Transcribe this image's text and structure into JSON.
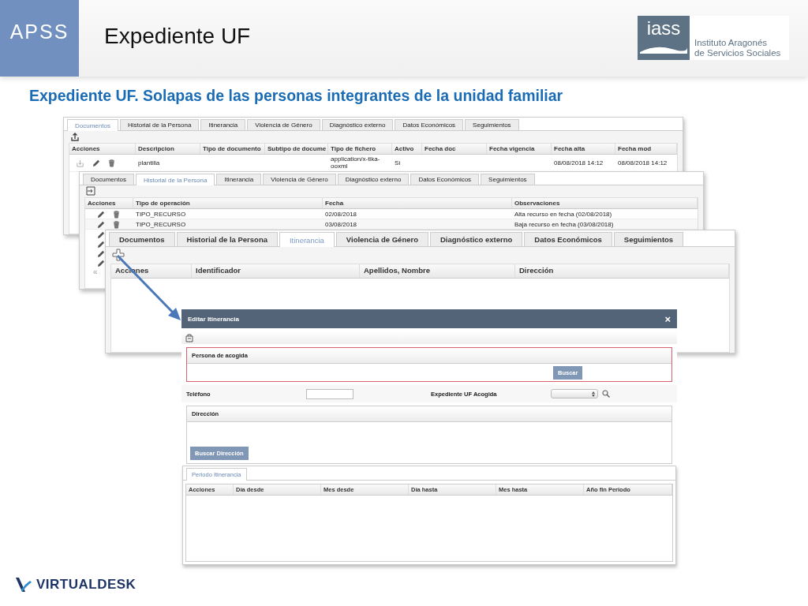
{
  "header": {
    "badge": "APSS",
    "title": "Expediente UF",
    "logo": {
      "mark": "iass",
      "lines": [
        "Instituto Aragonés",
        "de Servicios Sociales"
      ]
    }
  },
  "subtitle": "Expediente UF. Solapas de las personas integrantes de la unidad familiar",
  "panels": [
    {
      "tabs": [
        {
          "label": "Documentos",
          "selected": true
        },
        {
          "label": "Historial de la Persona",
          "selected": false
        },
        {
          "label": "Itinerancia",
          "selected": false
        },
        {
          "label": "Violencia de Género",
          "selected": false
        },
        {
          "label": "Diagnóstico externo",
          "selected": false
        },
        {
          "label": "Datos Económicos",
          "selected": false
        },
        {
          "label": "Seguimientos",
          "selected": false
        }
      ],
      "columns": [
        "Acciones",
        "Descripcion",
        "Tipo de documento",
        "Subtipo de docume",
        "Tipo de fichero",
        "Activo",
        "Fecha doc",
        "Fecha vigencia",
        "Fecha alta",
        "Fecha mod"
      ],
      "rows": [
        {
          "cells": [
            "",
            "plantilla",
            "",
            "",
            "application/x-tika-ooxml",
            "Sí",
            "",
            "",
            "08/08/2018 14:12",
            "08/08/2018 14:12"
          ]
        }
      ]
    },
    {
      "tabs": [
        {
          "label": "Documentos",
          "selected": false
        },
        {
          "label": "Historial de la Persona",
          "selected": true
        },
        {
          "label": "Itinerancia",
          "selected": false
        },
        {
          "label": "Violencia de Género",
          "selected": false
        },
        {
          "label": "Diagnóstico externo",
          "selected": false
        },
        {
          "label": "Datos Económicos",
          "selected": false
        },
        {
          "label": "Seguimientos",
          "selected": false
        }
      ],
      "columns": [
        "Acciones",
        "Tipo de operación",
        "Fecha",
        "Observaciones"
      ],
      "rows": [
        {
          "cells": [
            "",
            "TIPO_RECURSO",
            "02/08/2018",
            "Alta recurso en fecha (02/08/2018)"
          ]
        },
        {
          "cells": [
            "",
            "TIPO_RECURSO",
            "03/08/2018",
            "Baja recurso en fecha (03/08/2018)"
          ]
        }
      ],
      "pager": "«"
    },
    {
      "tabs": [
        {
          "label": "Documentos",
          "selected": false
        },
        {
          "label": "Historial de la Persona",
          "selected": false
        },
        {
          "label": "Itinerancia",
          "selected": true
        },
        {
          "label": "Violencia de Género",
          "selected": false
        },
        {
          "label": "Diagnóstico externo",
          "selected": false
        },
        {
          "label": "Datos Económicos",
          "selected": false
        },
        {
          "label": "Seguimientos",
          "selected": false
        }
      ],
      "columns": [
        "Acciones",
        "Identificador",
        "Apellidos, Nombre",
        "Dirección"
      ]
    }
  ],
  "dialog": {
    "title": "Editar Itinerancia",
    "close": "×",
    "persona": {
      "label": "Persona de acogida",
      "button": "Buscar"
    },
    "telefono": {
      "label": "Teléfono"
    },
    "expediente": {
      "label": "Expediente UF Acogida"
    },
    "direccion": {
      "label": "Dirección",
      "button": "Buscar Dirección"
    },
    "periodo": {
      "tabs": [
        {
          "label": "Periodo Itinerancia",
          "selected": true
        }
      ],
      "columns": [
        "Acciones",
        "Día desde",
        "Mes desde",
        "Día hasta",
        "Mes hasta",
        "Año fin Periodo"
      ]
    }
  },
  "footer": {
    "logo": "VIRTUALDESK"
  }
}
